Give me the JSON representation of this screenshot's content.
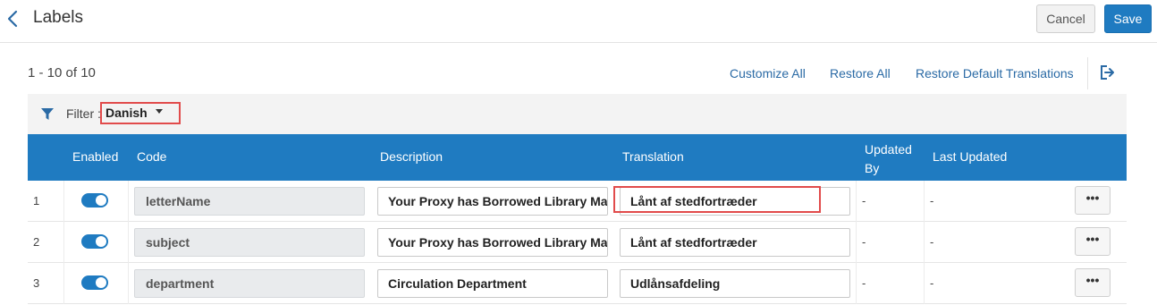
{
  "header": {
    "title": "Labels",
    "cancel_label": "Cancel",
    "save_label": "Save"
  },
  "toolbar": {
    "count": "1 - 10 of 10",
    "customize_all": "Customize All",
    "restore_all": "Restore All",
    "restore_default": "Restore Default Translations"
  },
  "filter": {
    "label": "Filter :",
    "selected": "Danish"
  },
  "table": {
    "columns": {
      "enabled": "Enabled",
      "code": "Code",
      "description": "Description",
      "translation": "Translation",
      "updated_by_1": "Updated",
      "updated_by_2": "By",
      "last_updated": "Last Updated"
    },
    "rows": [
      {
        "num": "1",
        "code": "letterName",
        "description": "Your Proxy has Borrowed Library Mate",
        "translation": "Lånt af stedfortræder",
        "updated_by": "-",
        "last_updated": "-",
        "more": "•••"
      },
      {
        "num": "2",
        "code": "subject",
        "description": "Your Proxy has Borrowed Library Mate",
        "translation": "Lånt af stedfortræder",
        "updated_by": "-",
        "last_updated": "-",
        "more": "•••"
      },
      {
        "num": "3",
        "code": "department",
        "description": "Circulation Department",
        "translation": "Udlånsafdeling",
        "updated_by": "-",
        "last_updated": "-",
        "more": "•••"
      }
    ]
  },
  "colors": {
    "accent": "#1f7bc1",
    "highlight": "#e14b4b"
  }
}
